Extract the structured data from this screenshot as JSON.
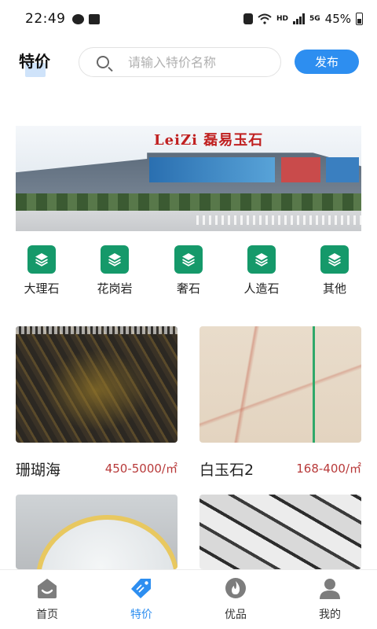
{
  "status_bar": {
    "time": "22:49",
    "network": "HD",
    "network_gen": "5G",
    "battery": "45%"
  },
  "header": {
    "title": "特价",
    "search_placeholder": "请输入特价名称",
    "publish_label": "发布"
  },
  "banner": {
    "sign_text": "LeiZi 磊易玉石"
  },
  "categories": [
    {
      "label": "大理石",
      "icon": "layers-icon"
    },
    {
      "label": "花岗岩",
      "icon": "layers-icon"
    },
    {
      "label": "奢石",
      "icon": "layers-icon"
    },
    {
      "label": "人造石",
      "icon": "layers-icon"
    },
    {
      "label": "其他",
      "icon": "layers-icon"
    }
  ],
  "products": [
    {
      "name": "珊瑚海",
      "price": "450-5000/㎡"
    },
    {
      "name": "白玉石2",
      "price": "168-400/㎡"
    },
    {
      "name": "",
      "price": ""
    },
    {
      "name": "",
      "price": ""
    }
  ],
  "bottom_nav": [
    {
      "label": "首页",
      "icon": "home-icon",
      "active": false
    },
    {
      "label": "特价",
      "icon": "tag-icon",
      "active": true
    },
    {
      "label": "优品",
      "icon": "fire-icon",
      "active": false
    },
    {
      "label": "我的",
      "icon": "user-icon",
      "active": false
    }
  ],
  "colors": {
    "accent": "#2d8ef0",
    "category_green": "#15996a",
    "price_red": "#b83a3a"
  }
}
